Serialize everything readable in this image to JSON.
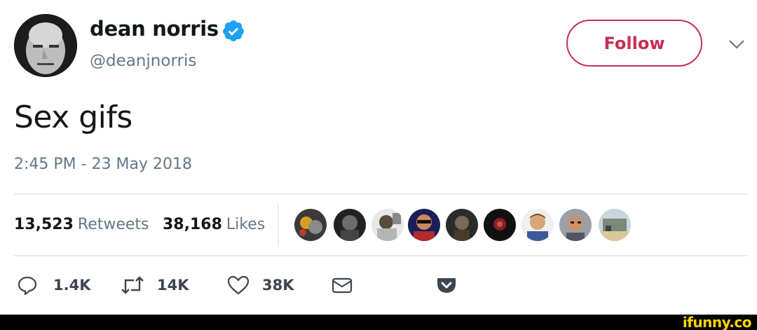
{
  "author": {
    "name": "dean norris",
    "handle": "@deanjnorris",
    "verified": true
  },
  "follow_button": {
    "label": "Follow"
  },
  "tweet": {
    "text": "Sex gifs",
    "timestamp": "2:45 PM - 23 May 2018"
  },
  "stats": {
    "retweets_count": "13,523",
    "retweets_label": "Retweets",
    "likes_count": "38,168",
    "likes_label": "Likes"
  },
  "actions": {
    "replies": "1.4K",
    "retweets": "14K",
    "likes": "38K"
  },
  "colors": {
    "follow_accent": "#c62f54",
    "verified_blue": "#1da1f2",
    "muted_text": "#657786",
    "pocket_red": "#ef4056",
    "watermark_yellow": "#ffd300"
  },
  "icons": [
    "verified-badge-icon",
    "chevron-down-icon",
    "reply-icon",
    "retweet-icon",
    "heart-icon",
    "envelope-icon",
    "pocket-icon"
  ],
  "watermark": "ifunny.co"
}
